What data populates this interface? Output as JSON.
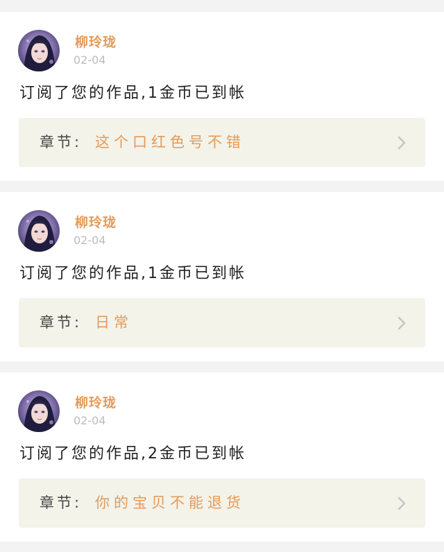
{
  "notifications": [
    {
      "username": "柳玲珑",
      "date": "02-04",
      "message": "订阅了您的作品,1金币已到帐",
      "chapter_label": "章节:",
      "chapter_title": "这个口红色号不错",
      "avatar_icon": "user-avatar-icon",
      "chevron_icon": "chevron-right-icon"
    },
    {
      "username": "柳玲珑",
      "date": "02-04",
      "message": "订阅了您的作品,1金币已到帐",
      "chapter_label": "章节:",
      "chapter_title": "日常",
      "avatar_icon": "user-avatar-icon",
      "chevron_icon": "chevron-right-icon"
    },
    {
      "username": "柳玲珑",
      "date": "02-04",
      "message": "订阅了您的作品,2金币已到帐",
      "chapter_label": "章节:",
      "chapter_title": "你的宝贝不能退货",
      "avatar_icon": "user-avatar-icon",
      "chevron_icon": "chevron-right-icon"
    }
  ],
  "colors": {
    "accent": "#e39a59",
    "page_background": "#f3f3f3",
    "card_background": "#ffffff",
    "chapter_background": "#f3f3ea",
    "muted_text": "#bdbdbd",
    "body_text": "#222222",
    "chevron": "#c4c4c4"
  }
}
